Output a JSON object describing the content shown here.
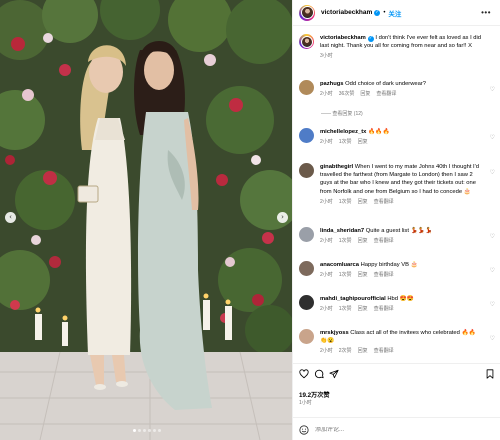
{
  "header": {
    "username": "victoriabeckham",
    "separator": "•",
    "follow_label": "关注",
    "more_icon": "more-horizontal-icon"
  },
  "caption": {
    "username": "victoriabeckham",
    "text": " I don't think I've ever felt as loved as I did last night. Thank you all for coming from near and so far!! X",
    "time": "3小时"
  },
  "comments": [
    {
      "username": "pazhugs",
      "text": " Odd choice of dark underwear?",
      "time": "2小时",
      "likes": "36次赞",
      "reply": "回复",
      "translate": "查看翻译",
      "avatar_color": "#b08a5a"
    },
    {
      "username": "michellelopez_tx",
      "text": " 🔥🔥🔥",
      "time": "2小时",
      "likes": "1次赞",
      "reply": "回复",
      "translate": "",
      "avatar_color": "#4f7cc7"
    },
    {
      "username": "ginabthegirl",
      "text": " When I went to my mate Johns 40th I thought I'd travelled the farthest (from Margate to London) then I saw 2 guys at the bar who I knew and they got their tickets out: one from Norfolk and one from Belgium so I had to concede 🎂",
      "time": "2小时",
      "likes": "1次赞",
      "reply": "回复",
      "translate": "查看翻译",
      "avatar_color": "#6b5a4a"
    },
    {
      "username": "linda_sheridan7",
      "text": " Quite a guest list 💃💃💃",
      "time": "2小时",
      "likes": "1次赞",
      "reply": "回复",
      "translate": "查看翻译",
      "avatar_color": "#9a9fa8"
    },
    {
      "username": "anacomluarca",
      "text": " Happy birthday VB 🎂",
      "time": "2小时",
      "likes": "1次赞",
      "reply": "回复",
      "translate": "查看翻译",
      "avatar_color": "#7d6a5c"
    },
    {
      "username": "mahdi_taghipourofficial",
      "text": " Hbd 😍😍",
      "time": "2小时",
      "likes": "1次赞",
      "reply": "回复",
      "translate": "查看翻译",
      "avatar_color": "#2f2f2f"
    },
    {
      "username": "mrskjyoss",
      "text": " Class act all of the invitees who celebrated 🔥🔥👏😮",
      "time": "2小时",
      "likes": "2次赞",
      "reply": "回复",
      "translate": "查看翻译",
      "avatar_color": "#c9a48b"
    }
  ],
  "view_replies": "—— 查看回复 (12)",
  "actions": {
    "likes": "19.2万次赞",
    "date": "1小时",
    "comment_placeholder": "添加评论..."
  },
  "carousel": {
    "slide_count": 6,
    "active_slide": 1
  },
  "colors": {
    "accent": "#0095f6",
    "like_red": "#ed4956",
    "muted": "#737373"
  }
}
